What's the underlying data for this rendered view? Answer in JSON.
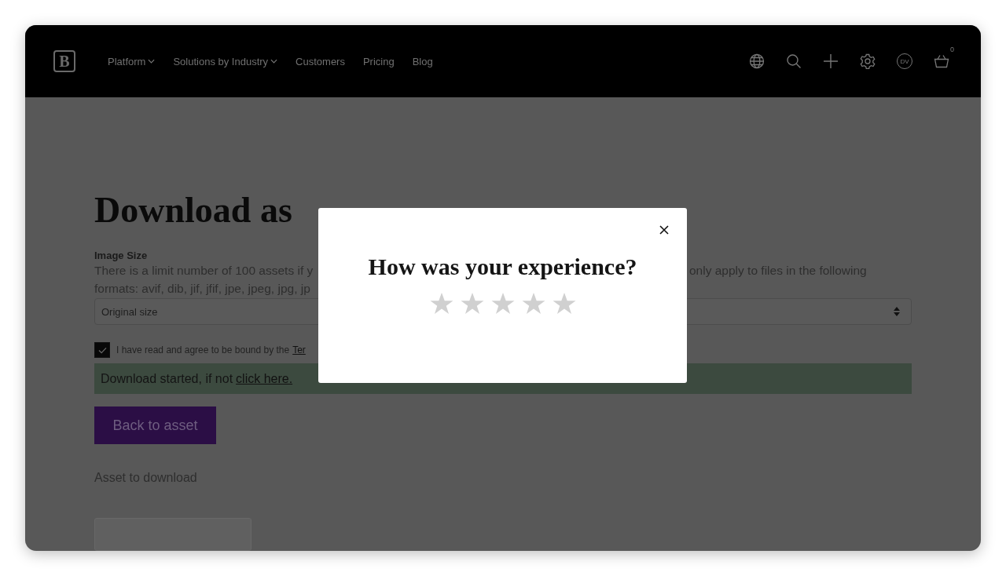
{
  "header": {
    "logo": {
      "text": "B"
    },
    "nav": [
      {
        "label": "Platform",
        "has_menu": true
      },
      {
        "label": "Solutions by Industry",
        "has_menu": true
      },
      {
        "label": "Customers",
        "has_menu": false
      },
      {
        "label": "Pricing",
        "has_menu": false
      },
      {
        "label": "Blog",
        "has_menu": false
      }
    ],
    "avatar": "DV",
    "cart_count": "0"
  },
  "page": {
    "title": "Download as",
    "field_label": "Image Size",
    "description_left": [
      "There is a limit number of 100 assets if y",
      "formats: avif, dib, jif, jfif, jpe, jpeg, jpg, jp"
    ],
    "description_right": "only apply to files in the following",
    "size_select": {
      "value": "Original size"
    },
    "terms": {
      "checked": true,
      "text": "I have read and agree to be bound by the",
      "link": "Ter"
    },
    "alert": {
      "text": "Download started, if not",
      "link": "click here."
    },
    "back_button": "Back to asset",
    "asset_label": "Asset to download"
  },
  "modal": {
    "title": "How was your experience?",
    "stars": 0
  }
}
